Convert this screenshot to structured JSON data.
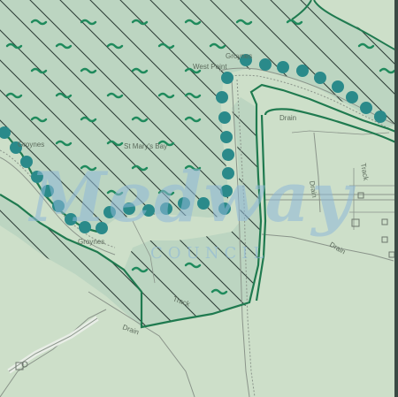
{
  "colors": {
    "land": "#cddfc9",
    "zone_fill": "#b9d3c0",
    "hatch": "#2b3a34",
    "boundary": "#1f7a4f",
    "dot": "#2a8a8a",
    "road": "#8a948a",
    "watermark": "#8fb8d8"
  },
  "watermark": {
    "main": "Medway",
    "sub": "COUNCIL",
    "icon": "medway-logo-watermark"
  },
  "labels": {
    "west_point": "West Point",
    "st_marys_bay": "St Mary's Bay",
    "groynes_left": "Groynes",
    "groynes_right": "Groynes",
    "groynes_bottom": "Groynes",
    "drain_right": "Drain",
    "drain_mid": "Drain",
    "drain_bottom": "Drain",
    "track_right": "Track",
    "track_bottom": "Track",
    "drain_vertical": "Drain"
  },
  "legend_symbols": {
    "hatch": "diagonal-hatch-zone",
    "wave": "green-wave-symbol",
    "dot": "teal-dot-marker"
  }
}
